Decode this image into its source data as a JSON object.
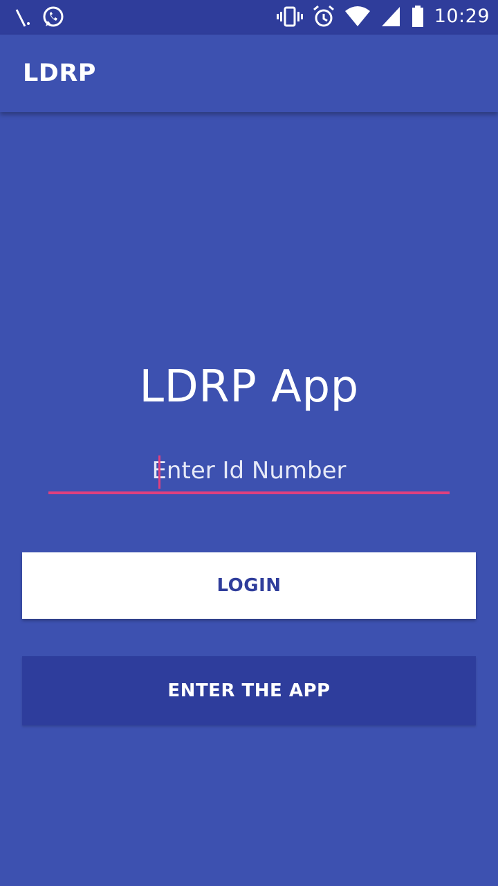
{
  "status_bar": {
    "time": "10:29",
    "icons_left": [
      "signal-slash-icon",
      "whatsapp-icon"
    ],
    "icons_right": [
      "vibrate-icon",
      "alarm-icon",
      "wifi-icon",
      "cell-signal-icon",
      "battery-icon"
    ]
  },
  "app_bar": {
    "title": "LDRP"
  },
  "main": {
    "title": "LDRP App",
    "id_input": {
      "placeholder": "Enter Id Number",
      "value": ""
    },
    "login_label": "LOGIN",
    "enter_label": "ENTER THE APP"
  },
  "colors": {
    "primary": "#3d51b0",
    "primary_dark": "#2f3d9b",
    "accent": "#e0407e",
    "button_white": "#ffffff"
  }
}
